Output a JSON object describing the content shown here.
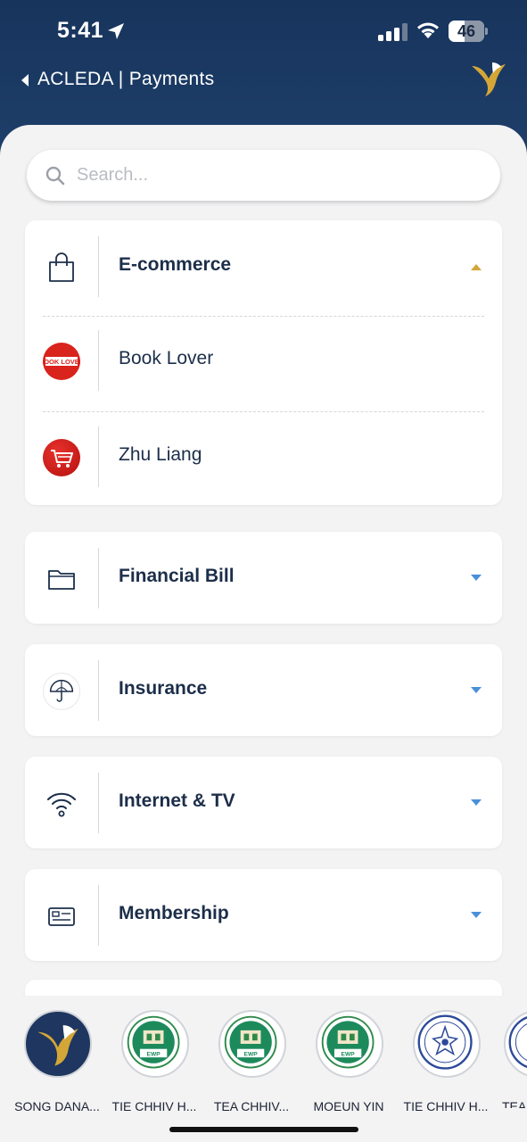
{
  "status_bar": {
    "time": "5:41",
    "battery": "46",
    "battery_level": 0.46
  },
  "nav": {
    "title": "ACLEDA | Payments"
  },
  "search": {
    "placeholder": "Search..."
  },
  "categories": [
    {
      "label": "E-commerce",
      "icon": "shopping-bag-icon",
      "expanded": true,
      "items": [
        {
          "label": "Book Lover",
          "icon": "book-lover-logo"
        },
        {
          "label": "Zhu Liang",
          "icon": "shopping-cart-logo"
        }
      ]
    },
    {
      "label": "Financial Bill",
      "icon": "folder-icon",
      "expanded": false
    },
    {
      "label": "Insurance",
      "icon": "umbrella-icon",
      "expanded": false
    },
    {
      "label": "Internet & TV",
      "icon": "wifi-icon",
      "expanded": false
    },
    {
      "label": "Membership",
      "icon": "id-card-icon",
      "expanded": false
    }
  ],
  "recent": [
    {
      "name": "SONG DANA...",
      "icon": "acleda-logo"
    },
    {
      "name": "TIE CHHIV H...",
      "icon": "ewp-logo"
    },
    {
      "name": "TEA CHHIV...",
      "icon": "ewp-logo"
    },
    {
      "name": "MOEUN YIN",
      "icon": "ewp-logo"
    },
    {
      "name": "TIE CHHIV H...",
      "icon": "edc-logo"
    },
    {
      "name": "TEA",
      "icon": "edc-logo"
    }
  ],
  "colors": {
    "header": "#1e3e69",
    "text": "#1c2e4a",
    "accent_gold": "#d4a637",
    "caret_blue": "#4a90d9",
    "book_lover_red": "#d9231d"
  }
}
